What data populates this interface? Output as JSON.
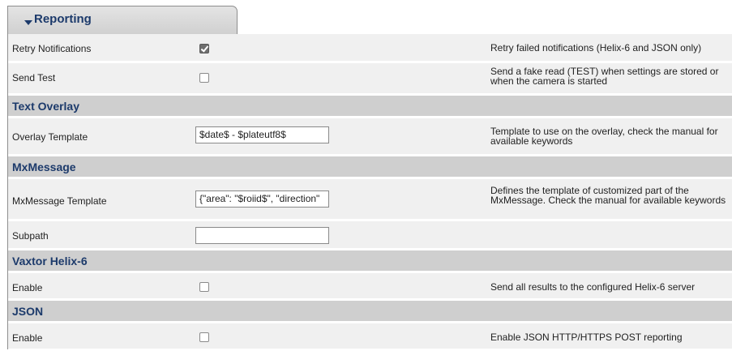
{
  "tab": {
    "label": "Reporting",
    "caret_icon": "caret-down-icon"
  },
  "reporting": {
    "retry": {
      "label": "Retry Notifications",
      "checked": true,
      "description": "Retry failed notifications (Helix-6 and JSON only)"
    },
    "send_test": {
      "label": "Send Test",
      "checked": false,
      "description": "Send a fake read (TEST) when settings are stored or when the camera is started"
    }
  },
  "text_overlay": {
    "title": "Text Overlay",
    "template": {
      "label": "Overlay Template",
      "value": "$date$ - $plateutf8$",
      "description": "Template to use on the overlay, check the manual for available keywords"
    }
  },
  "mxmessage": {
    "title": "MxMessage",
    "template": {
      "label": "MxMessage Template",
      "value": "{\"area\": \"$roiid$\", \"direction\"",
      "description": "Defines the template of customized part of the MxMessage. Check the manual for available keywords"
    },
    "subpath": {
      "label": "Subpath",
      "value": ""
    }
  },
  "vaxtor": {
    "title": "Vaxtor Helix-6",
    "enable": {
      "label": "Enable",
      "checked": false,
      "description": "Send all results to the configured Helix-6 server"
    }
  },
  "json": {
    "title": "JSON",
    "enable": {
      "label": "Enable",
      "checked": false,
      "description": "Enable JSON HTTP/HTTPS POST reporting"
    }
  }
}
